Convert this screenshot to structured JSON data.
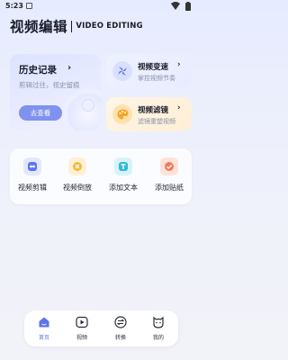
{
  "status_bar": {
    "time": "5:23"
  },
  "header": {
    "title_cn": "视频编辑",
    "title_en": "VIDEO EDITING"
  },
  "history": {
    "title": "历史记录",
    "arrow": "›",
    "subtitle": "剪辑过往，视史留痕",
    "button": "去查看"
  },
  "speed_card": {
    "title": "视频变速",
    "arrow": "›",
    "subtitle": "掌控视频节奏"
  },
  "filter_card": {
    "title": "视频滤镜",
    "arrow": "›",
    "subtitle": "滤镜重塑视频"
  },
  "tools": [
    {
      "label": "视频剪辑",
      "icon": "video-cut-icon",
      "color": "#5b74f0"
    },
    {
      "label": "视频倒放",
      "icon": "reverse-icon",
      "color": "#f5b73b"
    },
    {
      "label": "添加文本",
      "icon": "text-icon",
      "color": "#31b9d6"
    },
    {
      "label": "添加贴纸",
      "icon": "sticker-icon",
      "color": "#f07a5a"
    }
  ],
  "nav": [
    {
      "label": "首页",
      "icon": "home-icon",
      "active": true
    },
    {
      "label": "视频",
      "icon": "play-icon",
      "active": false
    },
    {
      "label": "转换",
      "icon": "convert-icon",
      "active": false
    },
    {
      "label": "我的",
      "icon": "profile-icon",
      "active": false
    }
  ],
  "colors": {
    "accent": "#5f73ea",
    "button": "#7f92ef"
  }
}
